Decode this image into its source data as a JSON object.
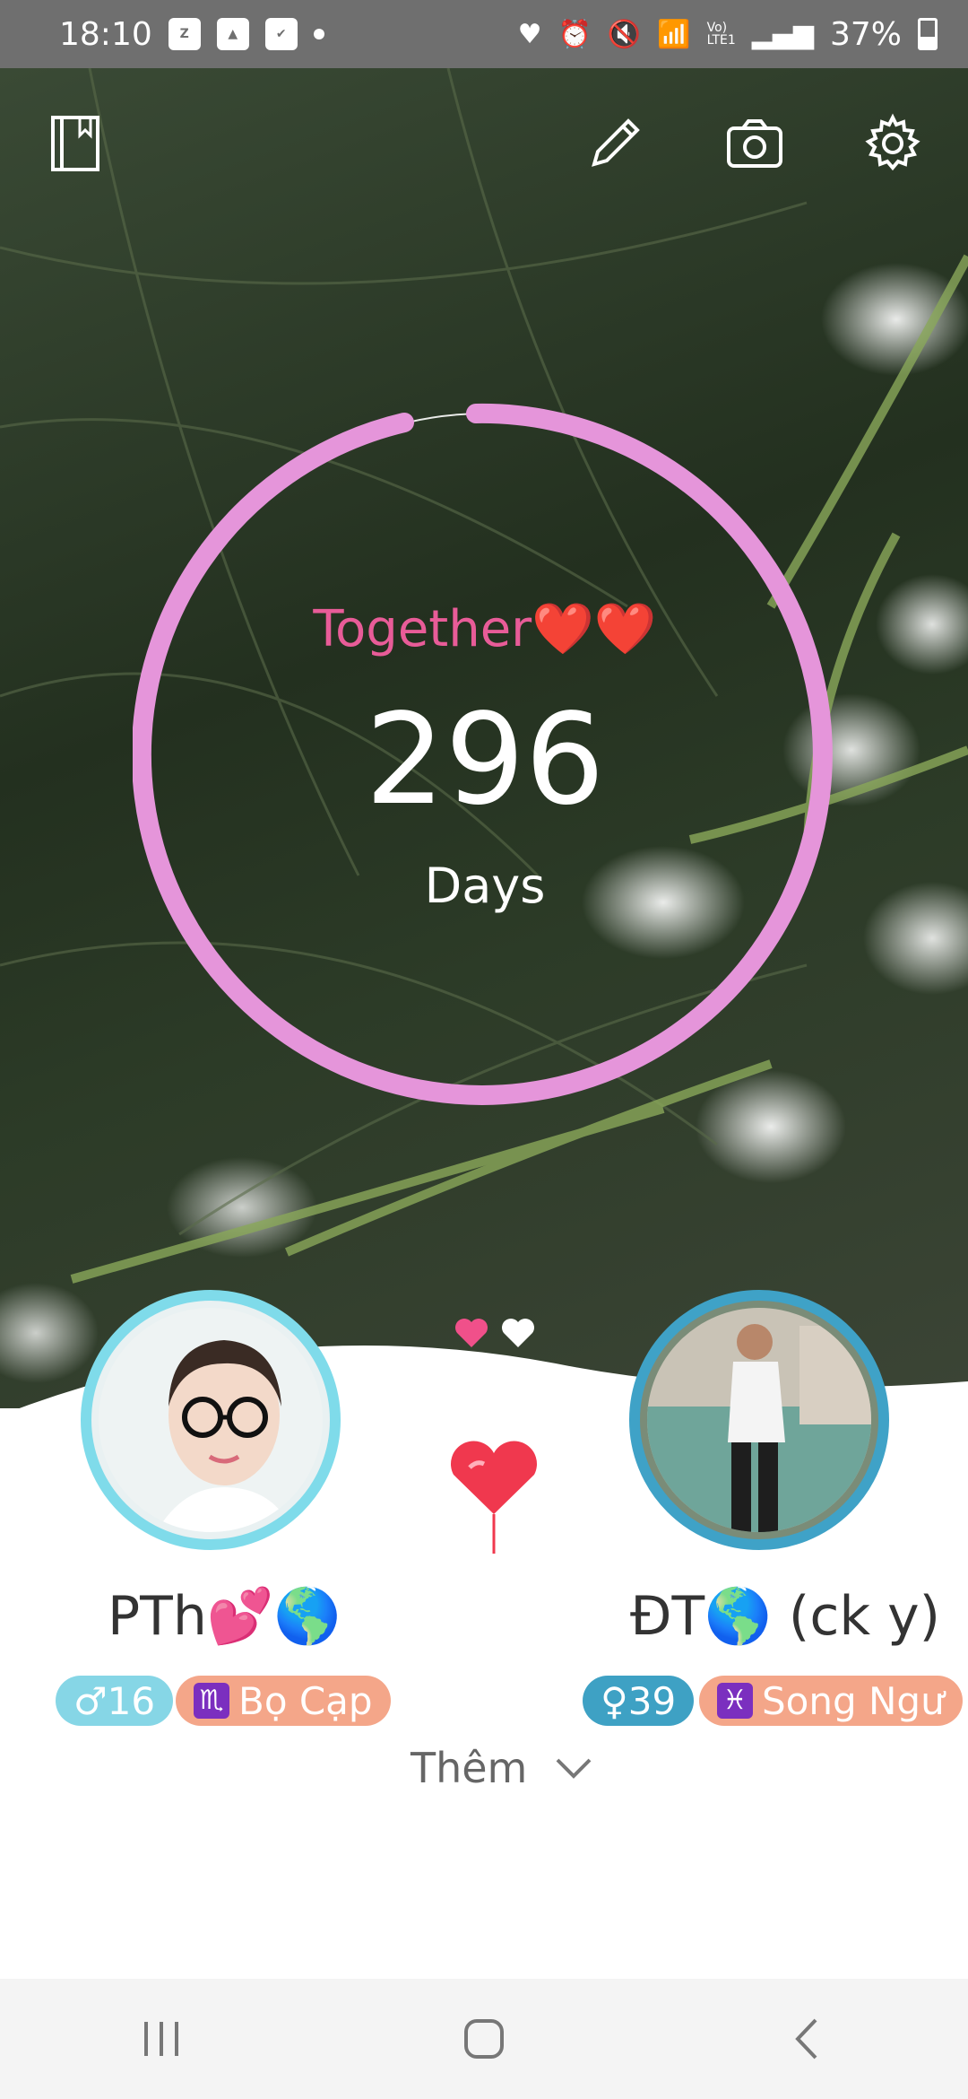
{
  "status_bar": {
    "time": "18:10",
    "app_icons": [
      "zalo-icon",
      "gallery-icon",
      "check-icon"
    ],
    "battery": "37%"
  },
  "toolbar": {
    "icons": [
      "book-icon",
      "pencil-icon",
      "camera-icon",
      "gear-icon"
    ]
  },
  "counter": {
    "title": "Together❤️❤️",
    "days": "296",
    "unit": "Days"
  },
  "partners": {
    "left": {
      "name": "PTh💕🌎",
      "age": "♂16",
      "zodiac_symbol": "♏",
      "zodiac": "Bọ Cạp"
    },
    "right": {
      "name": "ĐT🌎 (ck y)",
      "age": "♀39",
      "zodiac_symbol": "♓",
      "zodiac": "Song Ngư"
    }
  },
  "more_label": "Thêm",
  "colors": {
    "ring": "#e595da",
    "together_text": "#e85c98",
    "left_ring": "#7fdbea",
    "right_ring": "#3fa2c7",
    "zodiac_badge": "#f4a689",
    "balloon": "#f0384e"
  }
}
